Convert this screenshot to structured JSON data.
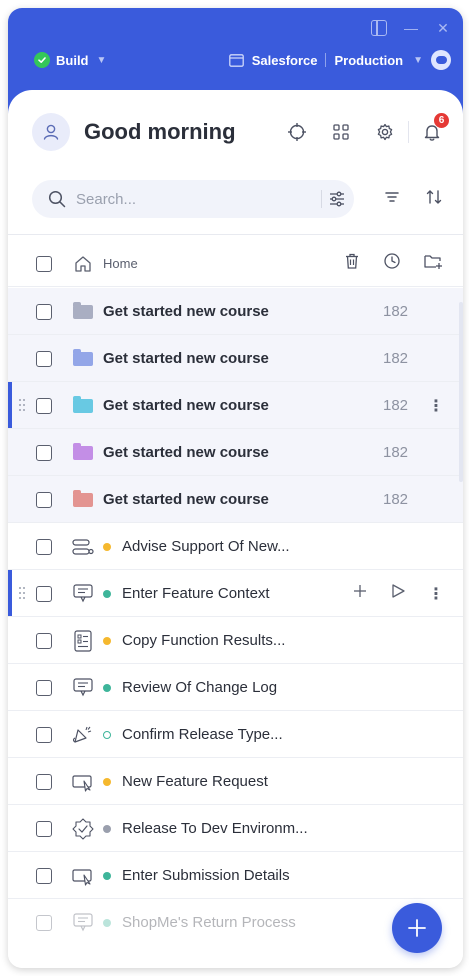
{
  "topbar": {
    "workspace_label": "Build",
    "system_label": "Salesforce",
    "environment_label": "Production"
  },
  "header": {
    "greeting": "Good morning",
    "notification_count": "6"
  },
  "search": {
    "placeholder": "Search..."
  },
  "home_row": {
    "label": "Home"
  },
  "folders": [
    {
      "label": "Get started new course",
      "count": "182",
      "color": "#a9aec2"
    },
    {
      "label": "Get started new course",
      "count": "182",
      "color": "#93a6e8"
    },
    {
      "label": "Get started new course",
      "count": "182",
      "color": "#68c9e3"
    },
    {
      "label": "Get started new course",
      "count": "182",
      "color": "#c38ee6"
    },
    {
      "label": "Get started new course",
      "count": "182",
      "color": "#e39491"
    }
  ],
  "items": [
    {
      "label": "Advise Support Of New...",
      "status_color": "#f5b82e",
      "icon": "flow-icon"
    },
    {
      "label": "Enter Feature Context",
      "status_color": "#3eb59a",
      "icon": "smart-tip-icon"
    },
    {
      "label": "Copy Function Results...",
      "status_color": "#f5b82e",
      "icon": "checklist-icon"
    },
    {
      "label": "Review Of Change Log",
      "status_color": "#3eb59a",
      "icon": "smart-tip-icon"
    },
    {
      "label": "Confirm Release Type...",
      "status_color": "#3eb59a",
      "icon": "announcement-icon"
    },
    {
      "label": "New Feature Request",
      "status_color": "#f5b82e",
      "icon": "launcher-icon"
    },
    {
      "label": "Release To Dev Environm...",
      "status_color": "#9a9fad",
      "icon": "resource-icon"
    },
    {
      "label": "Enter Submission Details",
      "status_color": "#3eb59a",
      "icon": "launcher-icon"
    },
    {
      "label": "ShopMe's Return Process",
      "status_color": "#3eb59a",
      "icon": "smart-tip-icon"
    }
  ],
  "colors": {
    "accent": "#3a5bdc",
    "badge": "#e53935",
    "status_green": "#3eb59a",
    "status_yellow": "#f5b82e"
  }
}
